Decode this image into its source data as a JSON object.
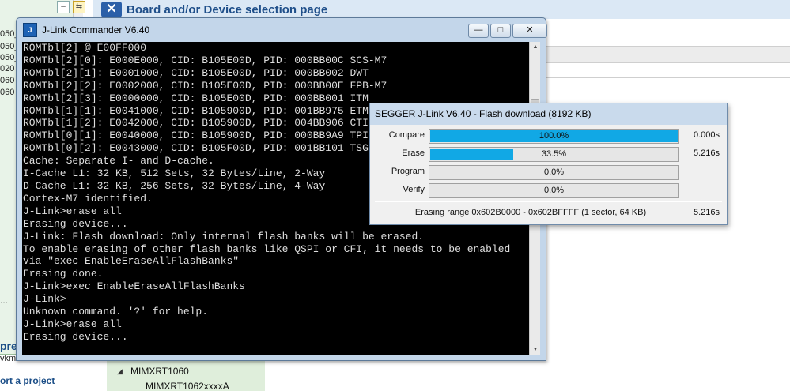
{
  "background": {
    "page_title": "Board and/or Device selection page",
    "left_tree": [
      "050_",
      "050_",
      "050_",
      "020",
      "060",
      "060"
    ],
    "left_dots": "...",
    "left_header": "pre",
    "left_vkm": "vkm",
    "left_import": "ort a project",
    "device_family": "MIMXRT1060",
    "device_item": "MIMXRT1062xxxxA"
  },
  "commander": {
    "title": "J-Link Commander V6.40",
    "icon_text": "J",
    "buttons": {
      "minimize": "—",
      "maximize": "□",
      "close": "✕"
    },
    "lines": [
      "ROMTbl[2] @ E00FF000",
      "ROMTbl[2][0]: E000E000, CID: B105E00D, PID: 000BB00C SCS-M7",
      "ROMTbl[2][1]: E0001000, CID: B105E00D, PID: 000BB002 DWT",
      "ROMTbl[2][2]: E0002000, CID: B105E00D, PID: 000BB00E FPB-M7",
      "ROMTbl[2][3]: E0000000, CID: B105E00D, PID: 000BB001 ITM",
      "ROMTbl[1][1]: E0041000, CID: B105900D, PID: 001BB975 ETM",
      "ROMTbl[1][2]: E0042000, CID: B105900D, PID: 004BB906 CTI",
      "ROMTbl[0][1]: E0040000, CID: B105900D, PID: 000BB9A9 TPIU",
      "ROMTbl[0][2]: E0043000, CID: B105F00D, PID: 001BB101 TSG",
      "Cache: Separate I- and D-cache.",
      "I-Cache L1: 32 KB, 512 Sets, 32 Bytes/Line, 2-Way",
      "D-Cache L1: 32 KB, 256 Sets, 32 Bytes/Line, 4-Way",
      "Cortex-M7 identified.",
      "J-Link>erase all",
      "Erasing device...",
      "J-Link: Flash download: Only internal flash banks will be erased.",
      "To enable erasing of other flash banks like QSPI or CFI, it needs to be enabled",
      "via \"exec EnableEraseAllFlashBanks\"",
      "Erasing done.",
      "J-Link>exec EnableEraseAllFlashBanks",
      "J-Link>",
      "Unknown command. '?' for help.",
      "J-Link>erase all",
      "Erasing device..."
    ]
  },
  "flash": {
    "title": "SEGGER J-Link V6.40 - Flash download (8192 KB)",
    "rows": [
      {
        "label": "Compare",
        "percent": "100.0%",
        "fill": 1.0,
        "time": "0.000s"
      },
      {
        "label": "Erase",
        "percent": "33.5%",
        "fill": 0.335,
        "time": "5.216s"
      },
      {
        "label": "Program",
        "percent": "0.0%",
        "fill": 0.0,
        "time": ""
      },
      {
        "label": "Verify",
        "percent": "0.0%",
        "fill": 0.0,
        "time": ""
      }
    ],
    "status": "Erasing range 0x602B0000 - 0x602BFFFF (1 sector, 64 KB)",
    "status_time": "5.216s",
    "bar_color": "#11a8e5"
  }
}
